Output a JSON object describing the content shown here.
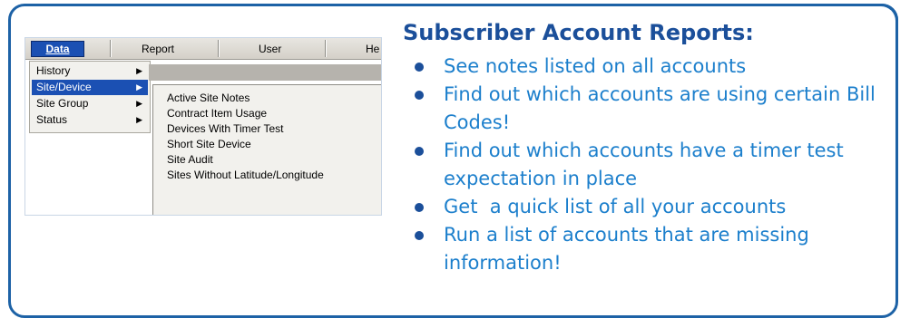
{
  "menubar": {
    "items": [
      {
        "label": "Data",
        "accel": "D"
      },
      {
        "label": "Report",
        "accel": "R"
      },
      {
        "label": "User",
        "accel": "s"
      },
      {
        "label": "He",
        "accel": "H"
      }
    ]
  },
  "dropdown": {
    "items": [
      {
        "label": "History",
        "has_submenu": true,
        "selected": false
      },
      {
        "label": "Site/Device",
        "has_submenu": true,
        "selected": true
      },
      {
        "label": "Site Group",
        "has_submenu": true,
        "selected": false
      },
      {
        "label": "Status",
        "has_submenu": true,
        "selected": false
      }
    ]
  },
  "submenu": {
    "items": [
      "Active Site Notes",
      "Contract Item Usage",
      "Devices With Timer Test",
      "Short Site Device",
      "Site Audit",
      "Sites Without Latitude/Longitude"
    ]
  },
  "panel": {
    "title": "Subscriber Account Reports:",
    "bullets": [
      "See notes listed on all accounts",
      "Find out which accounts are using certain Bill Codes!",
      "Find out which accounts have a timer test expectation in place",
      "Get  a quick list of all your accounts",
      "Run a list of accounts that are missing information!"
    ]
  },
  "colors": {
    "border": "#1d62a6",
    "title": "#1b4f9a",
    "bullet_text": "#1c7fcc",
    "menu_highlight": "#1b50b3"
  }
}
